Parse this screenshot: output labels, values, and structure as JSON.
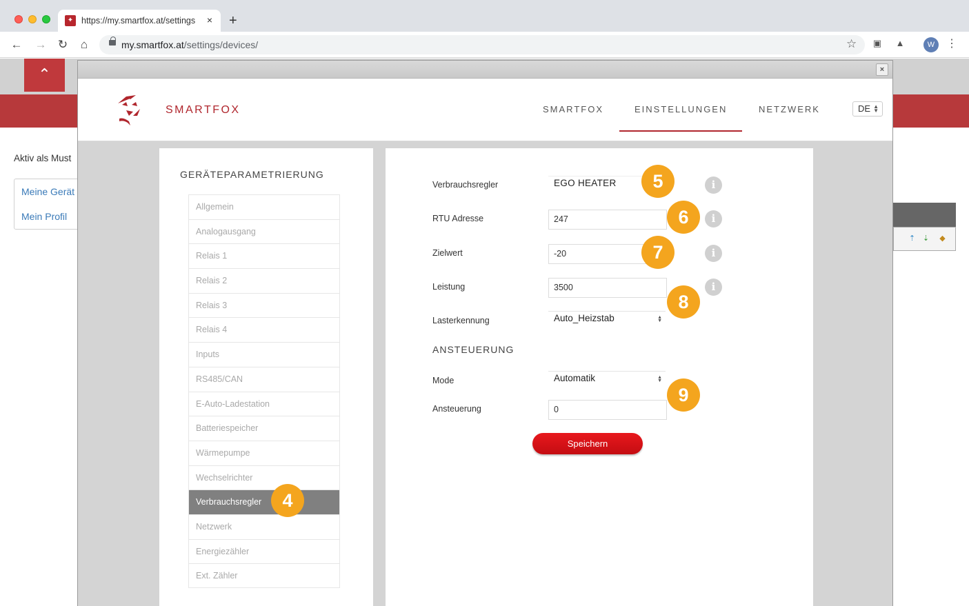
{
  "browser": {
    "tab_title": "https://my.smartfox.at/settings",
    "tab_close": "×",
    "new_tab": "+",
    "url_host": "my.smartfox.at",
    "url_path": "/settings/devices/",
    "profile_initial": "W"
  },
  "background_page": {
    "aktiv_text": "Aktiv als Must",
    "nav_items": [
      "Meine Gerät",
      "Mein Profil"
    ]
  },
  "modal": {
    "close_label": "×",
    "brand": "SMARTFOX",
    "nav": [
      "SMARTFOX",
      "EINSTELLUNGEN",
      "NETZWERK"
    ],
    "active_nav": "EINSTELLUNGEN",
    "language": "DE",
    "accent_color": "#b0262d"
  },
  "sidebar": {
    "title": "GERÄTEPARAMETRIERUNG",
    "items": [
      "Allgemein",
      "Analogausgang",
      "Relais 1",
      "Relais 2",
      "Relais 3",
      "Relais 4",
      "Inputs",
      "RS485/CAN",
      "E-Auto-Ladestation",
      "Batteriespeicher",
      "Wärmepumpe",
      "Wechselrichter",
      "Verbrauchsregler",
      "Netzwerk",
      "Energiezähler",
      "Ext. Zähler"
    ],
    "active_item": "Verbrauchsregler"
  },
  "form": {
    "verbrauchsregler": {
      "label": "Verbrauchsregler",
      "value": "EGO HEATER"
    },
    "rtu": {
      "label": "RTU Adresse",
      "value": "247"
    },
    "zielwert": {
      "label": "Zielwert",
      "value": "-20"
    },
    "leistung": {
      "label": "Leistung",
      "value": "3500"
    },
    "lasterkennung": {
      "label": "Lasterkennung",
      "value": "Auto_Heizstab"
    },
    "section_title": "ANSTEUERUNG",
    "mode": {
      "label": "Mode",
      "value": "Automatik"
    },
    "ansteuerung": {
      "label": "Ansteuerung",
      "value": "0"
    },
    "save_label": "Speichern",
    "info_glyph": "i"
  },
  "badges": [
    "4",
    "5",
    "6",
    "7",
    "8",
    "9"
  ],
  "badge_color": "#f4a51e"
}
